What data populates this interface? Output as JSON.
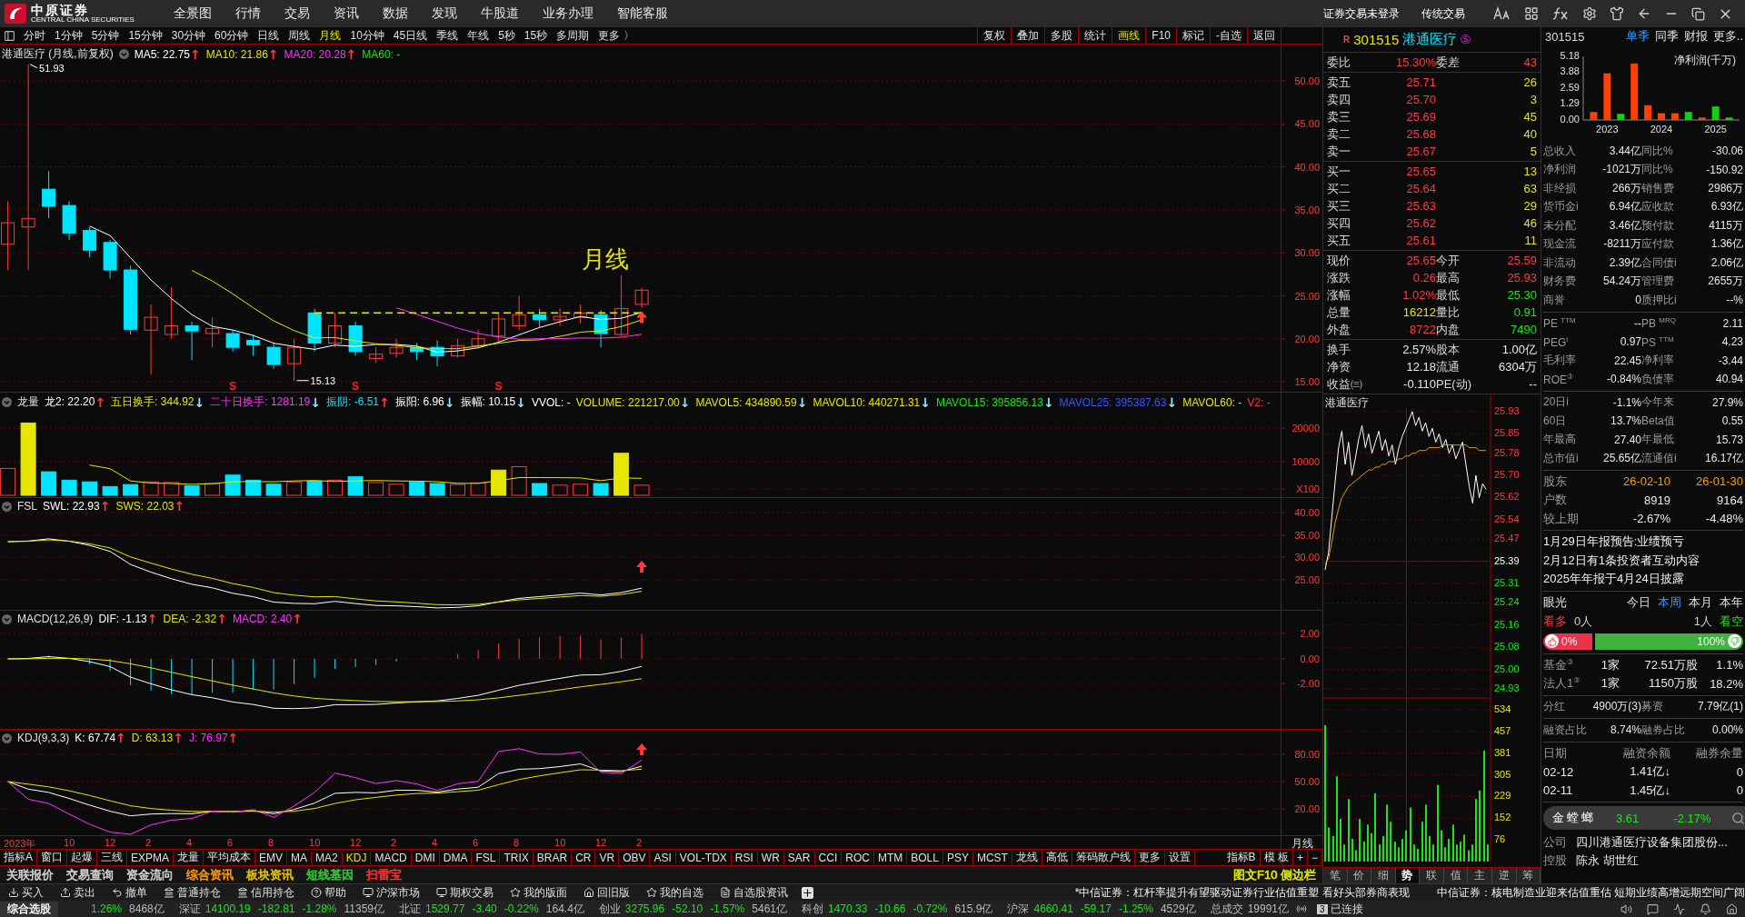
{
  "top_menu": {
    "logo_text": "中原证券",
    "logo_subtext": "CENTRAL CHINA SECURITIES",
    "items": [
      "全景图",
      "行情",
      "交易",
      "资讯",
      "数据",
      "发现",
      "牛股道",
      "业务办理",
      "智能客服"
    ],
    "right_items": [
      "证券交易未登录",
      "传统交易"
    ]
  },
  "period_bar": {
    "periods": [
      {
        "label": "分时",
        "selected": false
      },
      {
        "label": "1分钟",
        "selected": false
      },
      {
        "label": "5分钟",
        "selected": false
      },
      {
        "label": "15分钟",
        "selected": false
      },
      {
        "label": "30分钟",
        "selected": false
      },
      {
        "label": "60分钟",
        "selected": false
      },
      {
        "label": "日线",
        "selected": false
      },
      {
        "label": "周线",
        "selected": false
      },
      {
        "label": "月线",
        "selected": true
      },
      {
        "label": "10分钟",
        "selected": false
      },
      {
        "label": "45日线",
        "selected": false
      },
      {
        "label": "季线",
        "selected": false
      },
      {
        "label": "年线",
        "selected": false
      },
      {
        "label": "5秒",
        "selected": false
      },
      {
        "label": "15秒",
        "selected": false
      },
      {
        "label": "多周期",
        "selected": false
      },
      {
        "label": "更多 〉",
        "selected": false
      }
    ],
    "tools": [
      {
        "label": "复权",
        "selected": false
      },
      {
        "label": "叠加",
        "selected": false
      },
      {
        "label": "多股",
        "selected": false
      },
      {
        "label": "统计",
        "selected": false
      },
      {
        "label": "画线",
        "selected": true
      },
      {
        "label": "F10",
        "selected": false
      },
      {
        "label": "标记",
        "selected": false
      },
      {
        "label": "-自选",
        "selected": false
      },
      {
        "label": "返回",
        "selected": false
      }
    ]
  },
  "main_chart": {
    "title": "港通医疗 (月线,前复权)",
    "annotation": "月线",
    "high_label": "51.93",
    "low_label": "15.13",
    "signal_marks": [
      "S",
      "S",
      "S"
    ],
    "legend": [
      {
        "kind": "value",
        "text": "MA5: 22.75",
        "color": "#ffffff"
      },
      {
        "kind": "arrow",
        "text": "↑",
        "color": "#ff3b3b"
      },
      {
        "kind": "value",
        "text": "MA10: 21.86",
        "color": "#e6e600"
      },
      {
        "kind": "arrow",
        "text": "↑",
        "color": "#ff3b3b"
      },
      {
        "kind": "value",
        "text": "MA20: 20.28",
        "color": "#ff33ff"
      },
      {
        "kind": "arrow",
        "text": "↑",
        "color": "#ff3b3b"
      },
      {
        "kind": "value",
        "text": "MA60: -",
        "color": "#19e619"
      }
    ],
    "yticks": [
      "50.00",
      "45.00",
      "40.00",
      "35.00",
      "30.00",
      "25.00",
      "20.00",
      "15.00"
    ]
  },
  "indicators": [
    {
      "name": "龙量",
      "legend": [
        {
          "kind": "value",
          "text": "龙2: 22.20",
          "color": "#ffffff"
        },
        {
          "kind": "arrow",
          "text": "↑",
          "color": "#ff3b3b"
        },
        {
          "kind": "value",
          "text": "五日换手: 344.92",
          "color": "#e6e600"
        },
        {
          "kind": "arrow",
          "text": "↓",
          "color": "#8fe8ff"
        },
        {
          "kind": "value",
          "text": "二十日换手: 1281.19",
          "color": "#ff33ff"
        },
        {
          "kind": "arrow",
          "text": "↓",
          "color": "#8fe8ff"
        },
        {
          "kind": "value",
          "text": "振阴: -6.51",
          "color": "#00e5ff"
        },
        {
          "kind": "arrow",
          "text": "↑",
          "color": "#ff3b3b"
        },
        {
          "kind": "value",
          "text": "振阳: 6.96",
          "color": "#ffffff"
        },
        {
          "kind": "arrow",
          "text": "↓",
          "color": "#8fe8ff"
        },
        {
          "kind": "value",
          "text": "振幅: 10.15",
          "color": "#ffffff"
        },
        {
          "kind": "arrow",
          "text": "↓",
          "color": "#8fe8ff"
        },
        {
          "kind": "value",
          "text": "VVOL: -",
          "color": "#ffffff"
        },
        {
          "kind": "value",
          "text": "VOLUME: 221217.00",
          "color": "#e6e600"
        },
        {
          "kind": "arrow",
          "text": "↓",
          "color": "#8fe8ff"
        },
        {
          "kind": "value",
          "text": "MAVOL5: 434890.59",
          "color": "#e6e600"
        },
        {
          "kind": "arrow",
          "text": "↓",
          "color": "#8fe8ff"
        },
        {
          "kind": "value",
          "text": "MAVOL10: 440271.31",
          "color": "#e6e600"
        },
        {
          "kind": "arrow",
          "text": "↓",
          "color": "#8fe8ff"
        },
        {
          "kind": "value",
          "text": "MAVOL15: 395856.13",
          "color": "#19e619"
        },
        {
          "kind": "arrow",
          "text": "↓",
          "color": "#8fe8ff"
        },
        {
          "kind": "value",
          "text": "MAVOL25: 395387.63",
          "color": "#3355ff"
        },
        {
          "kind": "arrow",
          "text": "↓",
          "color": "#8fe8ff"
        },
        {
          "kind": "value",
          "text": "MAVOL60: -",
          "color": "#e6e600"
        },
        {
          "kind": "value",
          "text": "V2: -",
          "color": "#ff3333"
        }
      ],
      "yticks": [
        "20000",
        "10000",
        "X100"
      ]
    },
    {
      "name": "FSL",
      "legend": [
        {
          "kind": "value",
          "text": "SWL: 22.93",
          "color": "#ffffff"
        },
        {
          "kind": "arrow",
          "text": "↑",
          "color": "#ff3b3b"
        },
        {
          "kind": "value",
          "text": "SWS: 22.03",
          "color": "#e6e600"
        },
        {
          "kind": "arrow",
          "text": "↑",
          "color": "#ff3b3b"
        }
      ],
      "yticks": [
        "40.00",
        "35.00",
        "30.00",
        "25.00"
      ]
    },
    {
      "name": "MACD(12,26,9)",
      "legend": [
        {
          "kind": "value",
          "text": "DIF: -1.13",
          "color": "#ffffff"
        },
        {
          "kind": "arrow",
          "text": "↑",
          "color": "#ff3b3b"
        },
        {
          "kind": "value",
          "text": "DEA: -2.32",
          "color": "#e6e600"
        },
        {
          "kind": "arrow",
          "text": "↑",
          "color": "#ff3b3b"
        },
        {
          "kind": "value",
          "text": "MACD: 2.40",
          "color": "#ff33ff"
        },
        {
          "kind": "arrow",
          "text": "↑",
          "color": "#ff3b3b"
        }
      ],
      "yticks": [
        "2.00",
        "0.00",
        "-2.00"
      ]
    },
    {
      "name": "KDJ(9,3,3)",
      "legend": [
        {
          "kind": "value",
          "text": "K: 67.74",
          "color": "#ffffff"
        },
        {
          "kind": "arrow",
          "text": "↑",
          "color": "#ff3b3b"
        },
        {
          "kind": "value",
          "text": "D: 63.13",
          "color": "#e6e600"
        },
        {
          "kind": "arrow",
          "text": "↑",
          "color": "#ff3b3b"
        },
        {
          "kind": "value",
          "text": "J: 76.97",
          "color": "#ff33ff"
        },
        {
          "kind": "arrow",
          "text": "↑",
          "color": "#ff3b3b"
        }
      ],
      "yticks": [
        "80.00",
        "50.00",
        "20.00"
      ]
    }
  ],
  "date_axis": {
    "labels": [
      "2023年",
      "10",
      "12",
      "2",
      "4",
      "6",
      "8",
      "10",
      "12",
      "2",
      "4",
      "6",
      "8",
      "10",
      "12",
      "2"
    ],
    "period": "月线"
  },
  "indicator_tabs": {
    "left": [
      {
        "label": "指标A",
        "selected": false
      },
      {
        "label": "窗口",
        "selected": false
      },
      {
        "label": "起爆",
        "selected": false
      },
      {
        "label": "三线",
        "selected": false
      },
      {
        "label": "EXPMA",
        "selected": false
      },
      {
        "label": "龙量",
        "selected": false
      },
      {
        "label": "平均成本",
        "selected": false
      },
      {
        "label": "EMV",
        "selected": false
      },
      {
        "label": "MA",
        "selected": false
      },
      {
        "label": "MA2",
        "selected": false
      },
      {
        "label": "KDJ",
        "selected": true
      },
      {
        "label": "MACD",
        "selected": false
      },
      {
        "label": "DMI",
        "selected": false
      },
      {
        "label": "DMA",
        "selected": false
      },
      {
        "label": "FSL",
        "selected": false
      },
      {
        "label": "TRIX",
        "selected": false
      },
      {
        "label": "BRAR",
        "selected": false
      },
      {
        "label": "CR",
        "selected": false
      },
      {
        "label": "VR",
        "selected": false
      },
      {
        "label": "OBV",
        "selected": false
      },
      {
        "label": "ASI",
        "selected": false
      },
      {
        "label": "VOL-TDX",
        "selected": false
      },
      {
        "label": "RSI",
        "selected": false
      },
      {
        "label": "WR",
        "selected": false
      },
      {
        "label": "SAR",
        "selected": false
      },
      {
        "label": "CCI",
        "selected": false
      },
      {
        "label": "ROC",
        "selected": false
      },
      {
        "label": "MTM",
        "selected": false
      },
      {
        "label": "BOLL",
        "selected": false
      },
      {
        "label": "PSY",
        "selected": false
      },
      {
        "label": "MCST",
        "selected": false
      },
      {
        "label": "龙线",
        "selected": false
      },
      {
        "label": "高低",
        "selected": false
      },
      {
        "label": "筹码散户线",
        "selected": false
      },
      {
        "label": "更多",
        "selected": false
      },
      {
        "label": "设置",
        "selected": false
      }
    ],
    "right": [
      "指标B",
      "模 板",
      "+",
      "−"
    ]
  },
  "link_bar": {
    "items": [
      {
        "label": "关联报价",
        "color": "#d0d0d0"
      },
      {
        "label": "交易查询",
        "color": "#d0d0d0"
      },
      {
        "label": "资金流向",
        "color": "#d0d0d0"
      },
      {
        "label": "综合资讯",
        "color": "#ff9900"
      },
      {
        "label": "板块资讯",
        "color": "#e6c200"
      },
      {
        "label": "短线基因",
        "color": "#33cc33"
      },
      {
        "label": "扫雷宝",
        "color": "#ff3333"
      }
    ],
    "right": "图文F10 侧边栏"
  },
  "quote": {
    "flag": "R",
    "code": "301515",
    "name": "港通医疗",
    "badge": "Ⓢ",
    "weibi": {
      "l1": "委比",
      "v1": "15.30%",
      "l2": "委差",
      "v2": "43"
    },
    "asks": [
      {
        "label": "卖五",
        "price": "25.71",
        "volume": "26"
      },
      {
        "label": "卖四",
        "price": "25.70",
        "volume": "3"
      },
      {
        "label": "卖三",
        "price": "25.69",
        "volume": "45"
      },
      {
        "label": "卖二",
        "price": "25.68",
        "volume": "40"
      },
      {
        "label": "卖一",
        "price": "25.67",
        "volume": "5"
      }
    ],
    "bids": [
      {
        "label": "买一",
        "price": "25.65",
        "volume": "13"
      },
      {
        "label": "买二",
        "price": "25.64",
        "volume": "63"
      },
      {
        "label": "买三",
        "price": "25.63",
        "volume": "29"
      },
      {
        "label": "买四",
        "price": "25.62",
        "volume": "46"
      },
      {
        "label": "买五",
        "price": "25.61",
        "volume": "11"
      }
    ],
    "stats": [
      {
        "l1": "现价",
        "v1": {
          "text": "25.65",
          "color": "#ff3b3b"
        },
        "l2": "今开",
        "v2": {
          "text": "25.59",
          "color": "#ff3b3b"
        }
      },
      {
        "l1": "涨跌",
        "v1": {
          "text": "0.26",
          "color": "#ff3b3b"
        },
        "l2": "最高",
        "v2": {
          "text": "25.93",
          "color": "#ff3b3b"
        }
      },
      {
        "l1": "涨幅",
        "v1": {
          "text": "1.02%",
          "color": "#ff3b3b"
        },
        "l2": "最低",
        "v2": {
          "text": "25.30",
          "color": "#19e619"
        }
      },
      {
        "l1": "总量",
        "v1": {
          "text": "16212",
          "color": "#e6e600"
        },
        "l2": "量比",
        "v2": {
          "text": "0.91",
          "color": "#19e619"
        }
      },
      {
        "l1": "外盘",
        "v1": {
          "text": "8722",
          "color": "#ff3b3b"
        },
        "l2": "内盘",
        "v2": {
          "text": "7490",
          "color": "#19e619"
        }
      }
    ],
    "extra": [
      {
        "l1": "换手",
        "v1": "2.57%",
        "l2": "股本",
        "v2": "1.00亿"
      },
      {
        "l1": "净资",
        "v1": "12.18",
        "l2": "流通",
        "v2": "6304万"
      },
      {
        "l1": "收益㈢",
        "v1": "-0.110",
        "l2": "PE(动)",
        "v2": "--"
      }
    ]
  },
  "intraday": {
    "title": "港通医疗",
    "price_chart": {
      "chart_data": {
        "type": "line",
        "grid": true,
        "ylim": [
          24.93,
          25.93
        ],
        "yticks": [
          {
            "value": 25.93,
            "label": "25.93"
          },
          {
            "value": 25.85,
            "label": "25.85"
          },
          {
            "value": 25.78,
            "label": "25.78"
          },
          {
            "value": 25.7,
            "label": "25.70"
          },
          {
            "value": 25.62,
            "label": "25.62"
          },
          {
            "value": 25.54,
            "label": "25.54"
          },
          {
            "value": 25.47,
            "label": "25.47"
          },
          {
            "value": 25.39,
            "label": "25.39"
          },
          {
            "value": 25.31,
            "label": "25.31"
          },
          {
            "value": 25.24,
            "label": "25.24"
          },
          {
            "value": 25.16,
            "label": "25.16"
          },
          {
            "value": 25.08,
            "label": "25.08"
          },
          {
            "value": 25.0,
            "label": "25.00"
          },
          {
            "value": 24.93,
            "label": "24.93"
          }
        ],
        "series": [
          {
            "color": "#ffffff",
            "values": [
              25.36,
              25.42,
              25.55,
              25.68,
              25.8,
              25.86,
              25.74,
              25.82,
              25.7,
              25.76,
              25.83,
              25.88,
              25.8,
              25.85,
              25.78,
              25.82,
              25.86,
              25.79,
              25.83,
              25.77,
              25.81,
              25.74,
              25.8,
              25.84,
              25.87,
              25.9,
              25.93,
              25.88,
              25.91,
              25.86,
              25.89,
              25.84,
              25.87,
              25.82,
              25.85,
              25.8,
              25.83,
              25.78,
              25.81,
              25.76,
              25.79,
              25.82,
              25.74,
              25.66,
              25.6,
              25.7,
              25.62,
              25.67,
              25.65
            ]
          },
          {
            "color": "#e6a000",
            "values": [
              25.38,
              25.4,
              25.46,
              25.53,
              25.58,
              25.62,
              25.64,
              25.66,
              25.67,
              25.68,
              25.69,
              25.7,
              25.71,
              25.72,
              25.72,
              25.73,
              25.73,
              25.74,
              25.74,
              25.75,
              25.75,
              25.75,
              25.76,
              25.76,
              25.77,
              25.77,
              25.78,
              25.78,
              25.79,
              25.79,
              25.79,
              25.8,
              25.8,
              25.8,
              25.8,
              25.81,
              25.81,
              25.81,
              25.81,
              25.81,
              25.81,
              25.81,
              25.81,
              25.8,
              25.8,
              25.8,
              25.79,
              25.79,
              25.79
            ]
          }
        ]
      }
    },
    "volume_chart": {
      "chart_data": {
        "type": "bar",
        "grid": true,
        "ylim": [
          0,
          534
        ],
        "yticks": [
          534,
          457,
          381,
          305,
          229,
          152,
          76
        ],
        "series": [
          {
            "color": "#19e619",
            "values": [
              480,
              120,
              90,
              300,
              150,
              60,
              220,
              80,
              40,
              150,
              70,
              130,
              100,
              240,
              60,
              90,
              200,
              140,
              70,
              50,
              80,
              110,
              190,
              60,
              45,
              140,
              200,
              90,
              60,
              270,
              110,
              50,
              80,
              130,
              60,
              70,
              95,
              40,
              60,
              220,
              250,
              390,
              60
            ]
          }
        ]
      }
    },
    "tabs": [
      {
        "label": "笔",
        "selected": false
      },
      {
        "label": "价",
        "selected": false
      },
      {
        "label": "细",
        "selected": false
      },
      {
        "label": "势",
        "selected": true
      },
      {
        "label": "联",
        "selected": false
      },
      {
        "label": "值",
        "selected": false
      },
      {
        "label": "主",
        "selected": false
      },
      {
        "label": "逆",
        "selected": false
      },
      {
        "label": "筹",
        "selected": false
      }
    ]
  },
  "f10": {
    "code": "301515",
    "tabs": [
      {
        "label": "单季",
        "selected": true
      },
      {
        "label": "同季",
        "selected": false
      },
      {
        "label": "财报",
        "selected": false
      },
      {
        "label": "更多..",
        "selected": false
      }
    ],
    "profit_chart": {
      "chart_data": {
        "type": "bar",
        "title": "净利润(千万)",
        "categories": [
          null,
          "2023",
          null,
          null,
          null,
          "2024",
          null,
          null,
          null,
          "2025",
          null
        ],
        "ylim": [
          0,
          5.18
        ],
        "yticks": [
          {
            "value": 0,
            "label": "0.00"
          },
          {
            "value": 1.29,
            "label": "1.29"
          },
          {
            "value": 2.59,
            "label": "2.59"
          },
          {
            "value": 3.88,
            "label": "3.88"
          },
          {
            "value": 5.18,
            "label": "5.18"
          }
        ],
        "stacked": true,
        "series": [
          {
            "color": "#ff4000",
            "values": [
              0.65,
              3.8,
              null,
              4.6,
              1.2,
              0.55,
              0.55,
              null,
              0.2,
              null,
              null
            ]
          },
          {
            "color": "#10d010",
            "values": [
              null,
              null,
              0.5,
              null,
              null,
              null,
              null,
              0.65,
              null,
              1.1,
              0.2
            ]
          }
        ]
      }
    },
    "finance": [
      {
        "l1": "总收入",
        "v1": "3.44亿",
        "l2": "同比%",
        "v2": "-30.06"
      },
      {
        "l1": "净利润",
        "v1": "-1021万",
        "l2": "同比%",
        "v2": "-150.92"
      },
      {
        "l1": "非经损",
        "v1": "266万",
        "l2": "销售费",
        "v2": "2986万"
      },
      {
        "l1": "货币金i",
        "v1": "6.94亿",
        "l2": "应收款",
        "v2": "6.93亿"
      },
      {
        "l1": "未分配",
        "v1": "3.46亿",
        "l2": "预付款",
        "v2": "4115万"
      },
      {
        "l1": "现金流",
        "v1": "-8211万",
        "l2": "应付款",
        "v2": "1.36亿"
      },
      {
        "l1": "非流动",
        "v1": "2.39亿",
        "l2": "合同债i",
        "v2": "2.06亿"
      },
      {
        "l1": "财务费",
        "v1": "54.24万",
        "l2": "管理费",
        "v2": "2655万"
      },
      {
        "l1": "商誉",
        "v1": "0",
        "l2": "质押比i",
        "v2": "--%"
      }
    ],
    "valuation": [
      {
        "l1": "PE $^{TTM}$",
        "v1": "--",
        "l2": "PB $^{MRQ}$",
        "v2": "2.11"
      },
      {
        "l1": "PEG$^{i}$",
        "v1": "0.97",
        "l2": "PS $^{TTM}$",
        "v2": "4.23"
      },
      {
        "l1": "毛利率",
        "v1": "22.45",
        "l2": "净利率",
        "v2": "-3.44"
      },
      {
        "l1": "ROE$^{③}$",
        "v1": "-0.84%",
        "l2": "负债率",
        "v2": "40.94"
      }
    ],
    "performance": [
      {
        "l1": "20日i",
        "v1": "-1.1%",
        "l2": "今年来",
        "v2": "27.9%"
      },
      {
        "l1": "60日",
        "v1": "13.7%",
        "l2": "Beta值",
        "v2": "0.55"
      },
      {
        "l1": "年最高",
        "v1": "27.40",
        "l2": "年最低",
        "v2": "15.73"
      },
      {
        "l1": "总市值i",
        "v1": "25.65亿",
        "l2": "流通值i",
        "v2": "16.17亿"
      }
    ],
    "holders": [
      {
        "kind": "date",
        "label": "股东",
        "v1": "26-02-10",
        "v2": "26-01-30"
      },
      {
        "kind": "number",
        "label": "户数",
        "v1": "8919",
        "v2": "9164"
      },
      {
        "kind": "number",
        "label": "较上期",
        "v1": "-2.67%",
        "v2": "-4.48%"
      }
    ],
    "news": [
      "1月29日年报预告:业绩预亏",
      "2月12日有1条投资者互动内容",
      "2025年年报于4月24日披露"
    ],
    "vision": {
      "title": "眼光",
      "tabs": [
        {
          "label": "今日",
          "selected": false
        },
        {
          "label": "本周",
          "selected": true
        },
        {
          "label": "本月",
          "selected": false
        },
        {
          "label": "本年",
          "selected": false
        }
      ],
      "bull_label": "看多",
      "bull_count": "0人",
      "bear_count": "1人",
      "bear_label": "看空",
      "bull_pct": "0%",
      "bear_pct": "100%",
      "level": 0
    },
    "institutions": [
      {
        "label": "基金$^{③}$",
        "count": "1家",
        "shares": "72.51万股",
        "pct": "1.1%"
      },
      {
        "label": "法人1$^{③}$",
        "count": "1家",
        "shares": "1150万股",
        "pct": "18.2%"
      }
    ],
    "dividend": {
      "l1": "分红",
      "v1": "4900万(3)",
      "l2": "募资",
      "v2": "7.79亿(1)"
    },
    "margin_ratio": {
      "l1": "融资占比",
      "v1": "8.74%",
      "l2": "融券占比",
      "v2": "0.00%"
    },
    "margin": {
      "columns": [
        "日期",
        "融资余额",
        "融券余量"
      ],
      "rows": [
        {
          "date": "02-12",
          "balance": "1.41亿↓",
          "short": "0"
        },
        {
          "date": "02-11",
          "balance": "1.45亿↓",
          "short": "0"
        }
      ]
    },
    "company": [
      {
        "label": "公司",
        "value": "四川港通医疗设备集团股份..."
      },
      {
        "label": "控股",
        "value": "陈永 胡世红"
      }
    ]
  },
  "floating_ticker": {
    "name": "金螳螂",
    "price": "3.61",
    "change": "-2.17%"
  },
  "action_bar": {
    "items": [
      "买入",
      "卖出",
      "撤单",
      "普通持仓",
      "信用持仓",
      "帮助",
      "沪深市场",
      "期权交易",
      "我的版面",
      "回旧版",
      "我的自选",
      "自选股资讯"
    ],
    "news": [
      "*中信证券：杠杆率提升有望驱动证券行业估值重塑 看好头部券商表现",
      "中信证券：核电制造业迎来估值重估 短期业绩高增远期空间广阔"
    ]
  },
  "status_bar": {
    "label": "综合选股",
    "indices": [
      {
        "figures": [
          "1.26%"
        ],
        "amount": "8468亿"
      },
      {
        "name": "深证",
        "figures": [
          "14100.19",
          "-182.81",
          "-1.28%"
        ],
        "amount": "11359亿"
      },
      {
        "name": "北证",
        "figures": [
          "1529.77",
          "-3.40",
          "-0.22%"
        ],
        "amount": "164.4亿"
      },
      {
        "name": "创业",
        "figures": [
          "3275.96",
          "-52.10",
          "-1.57%"
        ],
        "amount": "5461亿"
      },
      {
        "name": "科创",
        "figures": [
          "1470.33",
          "-10.66",
          "-0.72%"
        ],
        "amount": "615.9亿"
      },
      {
        "name": "沪深",
        "figures": [
          "4660.41",
          "-59.17",
          "-1.25%"
        ],
        "amount": "4529亿"
      }
    ],
    "total_label": "总成交",
    "total": "19991亿",
    "connections": "3",
    "connection_status": "已连接"
  }
}
